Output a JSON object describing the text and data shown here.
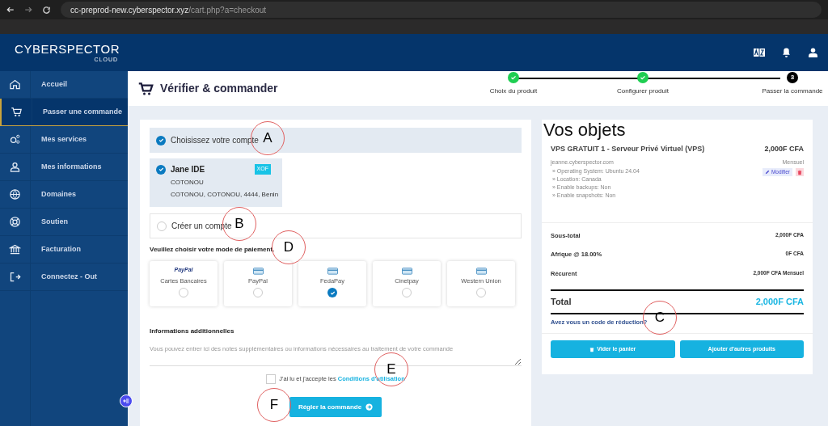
{
  "browser": {
    "url_host": "cc-preprod-new.cyberspector.xyz",
    "url_path": "/cart.php?a=checkout"
  },
  "header": {
    "logo_main": "CYBERSPECTOR",
    "logo_sub": "CLOUD"
  },
  "sidebar": {
    "items": [
      {
        "label": "Accueil",
        "selected": false
      },
      {
        "label": "Passer une commande",
        "selected": true
      },
      {
        "label": "Mes services",
        "selected": false
      },
      {
        "label": "Mes informations",
        "selected": false
      },
      {
        "label": "Domaines",
        "selected": false
      },
      {
        "label": "Soutien",
        "selected": false
      },
      {
        "label": "Facturation",
        "selected": false
      },
      {
        "label": "Connectez - Out",
        "selected": false
      }
    ]
  },
  "page_title": "Vérifier & commander",
  "steps": [
    {
      "label": "Choix du produit",
      "done": true
    },
    {
      "label": "Configurer produit",
      "done": true
    },
    {
      "label": "Passer la commande",
      "done": false,
      "number": "3"
    }
  ],
  "account_options": [
    {
      "label": "Choisissez votre compte",
      "selected": true
    },
    {
      "label": "Créer un compte",
      "selected": false
    }
  ],
  "account": {
    "name": "Jane IDE",
    "currency": "XOF",
    "line1": "COTONOU",
    "line2": "COTONOU, COTONOU, 4444, Benin",
    "selected": true
  },
  "payment": {
    "label": "Veuillez choisir votre mode de paiement.",
    "methods": [
      {
        "label": "Cartes Bancaires",
        "kind": "paypal",
        "logo": "PayPal",
        "selected": false
      },
      {
        "label": "PayPal",
        "kind": "card",
        "selected": false
      },
      {
        "label": "FedaPay",
        "kind": "card",
        "selected": true
      },
      {
        "label": "Cinetpay",
        "kind": "card",
        "selected": false
      },
      {
        "label": "Western Union",
        "kind": "card",
        "selected": false
      }
    ]
  },
  "notes": {
    "label": "Informations additionnelles",
    "placeholder": "Vous pouvez entrer ici des notes supplémentaires ou informations nécessaires au traitement de votre commande"
  },
  "terms": {
    "text": "J'ai lu et j'accepte les",
    "link": "Conditions d'utilisation",
    "checked": false
  },
  "submit": "Régler la commande",
  "cart": {
    "title": "Vos objets",
    "item": {
      "name": "VPS GRATUIT 1 - Serveur Privé Virtuel (VPS)",
      "domain": "jeanne.cyberspector.com",
      "price": "2,000F CFA",
      "cycle": "Mensuel",
      "edit": "Modifier",
      "options": [
        "» Operating System: Ubuntu 24.04",
        "» Location: Canada",
        "» Enable backups: Non",
        "» Enable snapshots: Non"
      ]
    },
    "totals": [
      {
        "label": "Sous-total",
        "value": "2,000F CFA"
      },
      {
        "label": "Afrique @ 18.00%",
        "value": "0F CFA"
      },
      {
        "label": "Récurent",
        "value": "2,000F CFA Mensuel"
      }
    ],
    "total_label": "Total",
    "total_value": "2,000F CFA",
    "promo": "Avez vous un code de réduction?",
    "empty": "Vider le panier",
    "more": "Ajouter d'autres produits"
  },
  "annotations": [
    "A",
    "B",
    "C",
    "D",
    "E",
    "F"
  ]
}
